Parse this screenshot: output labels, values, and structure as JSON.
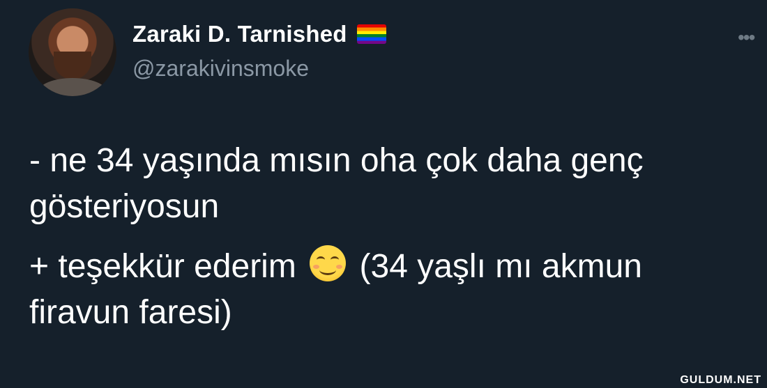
{
  "author": {
    "display_name": "Zaraki D. Tarnished",
    "handle": "@zarakivinsmoke",
    "avatar_icon": "profile-photo",
    "name_badge_icon": "rainbow-flag-icon"
  },
  "menu": {
    "more_icon": "more-options-icon",
    "more_glyph": "•••"
  },
  "tweet": {
    "line1": "- ne 34 yaşında mısın oha çok daha genç gösteriyosun",
    "line2_before_emoji": "+ teşekkür ederim ",
    "emoji_icon": "smiling-face-icon",
    "line2_after_emoji": " (34 yaşlı mı akmun firavun faresi)"
  },
  "watermark": "GULDUM.NET",
  "colors": {
    "background": "#15202b",
    "text": "#ffffff",
    "secondary_text": "#8b98a5"
  }
}
